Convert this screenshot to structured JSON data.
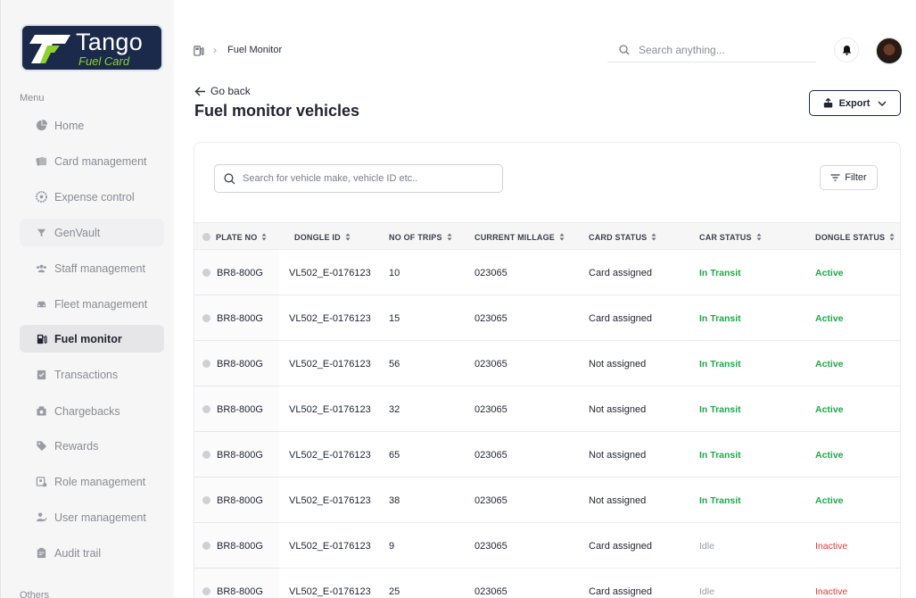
{
  "logo": {
    "brand": "Tango",
    "sub": "Fuel Card"
  },
  "menu_label": "Menu",
  "others_label": "Others",
  "nav": [
    {
      "label": "Home",
      "icon": "pie-chart-icon"
    },
    {
      "label": "Card management",
      "icon": "cards-icon"
    },
    {
      "label": "Expense control",
      "icon": "gauge-icon"
    },
    {
      "label": "GenVault",
      "icon": "funnel-icon"
    },
    {
      "label": "Staff management",
      "icon": "users-icon"
    },
    {
      "label": "Fleet management",
      "icon": "car-icon"
    },
    {
      "label": "Fuel monitor",
      "icon": "fuel-pump-icon",
      "active": true
    },
    {
      "label": "Transactions",
      "icon": "receipt-icon"
    },
    {
      "label": "Chargebacks",
      "icon": "wallet-icon"
    },
    {
      "label": "Rewards",
      "icon": "tag-icon"
    },
    {
      "label": "Role management",
      "icon": "badge-icon"
    },
    {
      "label": "User management",
      "icon": "user-check-icon"
    },
    {
      "label": "Audit trail",
      "icon": "clipboard-icon"
    }
  ],
  "header": {
    "breadcrumb": "Fuel Monitor",
    "search_placeholder": "Search anything..."
  },
  "page": {
    "go_back": "Go back",
    "title": "Fuel monitor vehicles",
    "export_label": "Export"
  },
  "table": {
    "search_placeholder": "Search for vehicle make, vehicle ID etc..",
    "filter_label": "Filter",
    "columns": [
      "PLATE NO",
      "DONGLE ID",
      "NO OF TRIPS",
      "CURRENT MILLAGE",
      "CARD STATUS",
      "CAR STATUS",
      "DONGLE STATUS"
    ],
    "rows": [
      {
        "plate": "BR8-800G",
        "dongle": "VL502_E-0176123",
        "trips": "10",
        "millage": "023065",
        "card": "Card assigned",
        "car": "In Transit",
        "dongle_status": "Active"
      },
      {
        "plate": "BR8-800G",
        "dongle": "VL502_E-0176123",
        "trips": "15",
        "millage": "023065",
        "card": "Card assigned",
        "car": "In Transit",
        "dongle_status": "Active"
      },
      {
        "plate": "BR8-800G",
        "dongle": "VL502_E-0176123",
        "trips": "56",
        "millage": "023065",
        "card": "Not assigned",
        "car": "In Transit",
        "dongle_status": "Active"
      },
      {
        "plate": "BR8-800G",
        "dongle": "VL502_E-0176123",
        "trips": "32",
        "millage": "023065",
        "card": "Not assigned",
        "car": "In Transit",
        "dongle_status": "Active"
      },
      {
        "plate": "BR8-800G",
        "dongle": "VL502_E-0176123",
        "trips": "65",
        "millage": "023065",
        "card": "Not assigned",
        "car": "In Transit",
        "dongle_status": "Active"
      },
      {
        "plate": "BR8-800G",
        "dongle": "VL502_E-0176123",
        "trips": "38",
        "millage": "023065",
        "card": "Not assigned",
        "car": "In Transit",
        "dongle_status": "Active"
      },
      {
        "plate": "BR8-800G",
        "dongle": "VL502_E-0176123",
        "trips": "9",
        "millage": "023065",
        "card": "Card assigned",
        "car": "Idle",
        "dongle_status": "Inactive"
      },
      {
        "plate": "BR8-800G",
        "dongle": "VL502_E-0176123",
        "trips": "25",
        "millage": "023065",
        "card": "Card assigned",
        "car": "Idle",
        "dongle_status": "Inactive"
      }
    ]
  },
  "colors": {
    "brand_navy": "#1b2a4b",
    "brand_green": "#8ed12f",
    "active_green": "#1ea84b",
    "inactive_red": "#e53935"
  }
}
